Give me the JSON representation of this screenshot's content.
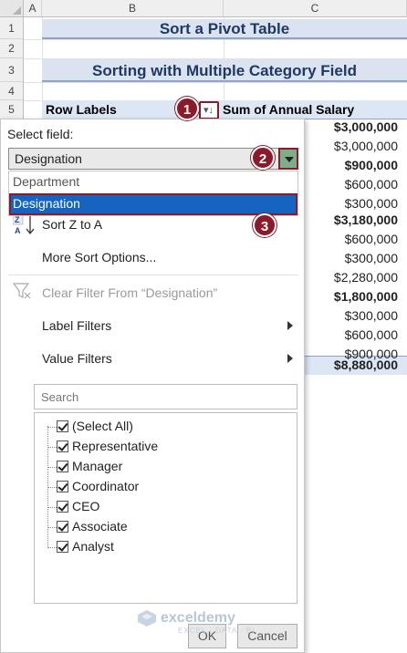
{
  "sheet": {
    "columns": [
      "A",
      "B",
      "C"
    ],
    "rows": [
      "1",
      "2",
      "3",
      "4",
      "5"
    ],
    "title1": "Sort a Pivot Table",
    "title2": "Sorting with Multiple Category Field",
    "row_labels_header": "Row Labels",
    "sum_header": "Sum of Annual Salary",
    "values": [
      {
        "v": "$3,000,000",
        "bold": true
      },
      {
        "v": "$3,000,000",
        "bold": false
      },
      {
        "v": "$900,000",
        "bold": true
      },
      {
        "v": "$600,000",
        "bold": false
      },
      {
        "v": "$300,000",
        "bold": false
      },
      {
        "v": "$3,180,000",
        "bold": true
      },
      {
        "v": "$600,000",
        "bold": false
      },
      {
        "v": "$300,000",
        "bold": false
      },
      {
        "v": "$2,280,000",
        "bold": false
      },
      {
        "v": "$1,800,000",
        "bold": true
      },
      {
        "v": "$300,000",
        "bold": false
      },
      {
        "v": "$600,000",
        "bold": false
      },
      {
        "v": "$900,000",
        "bold": false
      },
      {
        "v": "$8,880,000",
        "bold": true
      }
    ]
  },
  "badges": [
    "1",
    "2",
    "3"
  ],
  "menu": {
    "select_label": "Select field:",
    "selected_field": "Designation",
    "dropdown_options": [
      "Department",
      "Designation"
    ],
    "sort_z_to_a": "Sort Z to A",
    "more_sort": "More Sort Options...",
    "clear_filter": "Clear Filter From “Designation”",
    "label_filters": "Label Filters",
    "value_filters": "Value Filters",
    "search_placeholder": "Search",
    "items": [
      "(Select All)",
      "Representative",
      "Manager",
      "Coordinator",
      "CEO",
      "Associate",
      "Analyst"
    ],
    "ok": "OK",
    "cancel": "Cancel"
  },
  "watermark": {
    "name": "exceldemy",
    "tagline": "EXCEL · DATA · BI"
  },
  "colors": {
    "accent": "#8b1a2b",
    "selected": "#1565c0",
    "header_fill": "#dce6f4"
  }
}
